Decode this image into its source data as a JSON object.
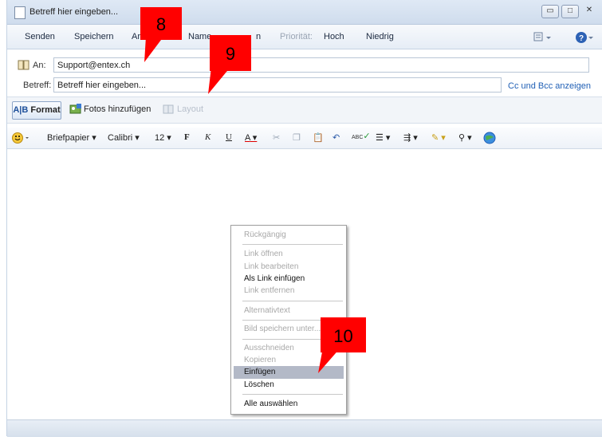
{
  "window": {
    "title": "Betreff hier eingeben..."
  },
  "window_controls": {
    "minimize": "▭",
    "maximize": "□",
    "close": "✕"
  },
  "toolbar": {
    "send": "Senden",
    "save": "Speichern",
    "attach_partial": "Ar",
    "names_partial": "Name",
    "check_partial": "n",
    "priority_label": "Priorität:",
    "high": "Hoch",
    "low": "Niedrig"
  },
  "header": {
    "to_label": "An:",
    "to_value": "Support@entex.ch",
    "subject_label": "Betreff:",
    "subject_value": "Betreff hier eingeben...",
    "cc_link": "Cc und Bcc anzeigen"
  },
  "tabs": {
    "format": "Format",
    "add_photos": "Fotos hinzufügen",
    "layout": "Layout"
  },
  "format_bar": {
    "stationery": "Briefpapier",
    "font": "Calibri",
    "size": "12",
    "bold": "F",
    "italic": "K",
    "underline": "U",
    "font_color": "A",
    "spellcheck": "ABC"
  },
  "context_menu": {
    "undo": "Rückgängig",
    "open_link": "Link öffnen",
    "edit_link": "Link bearbeiten",
    "paste_as_link": "Als Link einfügen",
    "remove_link": "Link entfernen",
    "alt_text": "Alternativtext",
    "save_image": "Bild speichern unter...",
    "cut": "Ausschneiden",
    "copy": "Kopieren",
    "paste": "Einfügen",
    "delete": "Löschen",
    "select_all": "Alle auswählen"
  },
  "annotations": {
    "a8": "8",
    "a9": "9",
    "a10": "10"
  },
  "colors": {
    "annotation": "#ff0000",
    "highlight": "#b3b9c7",
    "link": "#1f5fb5"
  }
}
